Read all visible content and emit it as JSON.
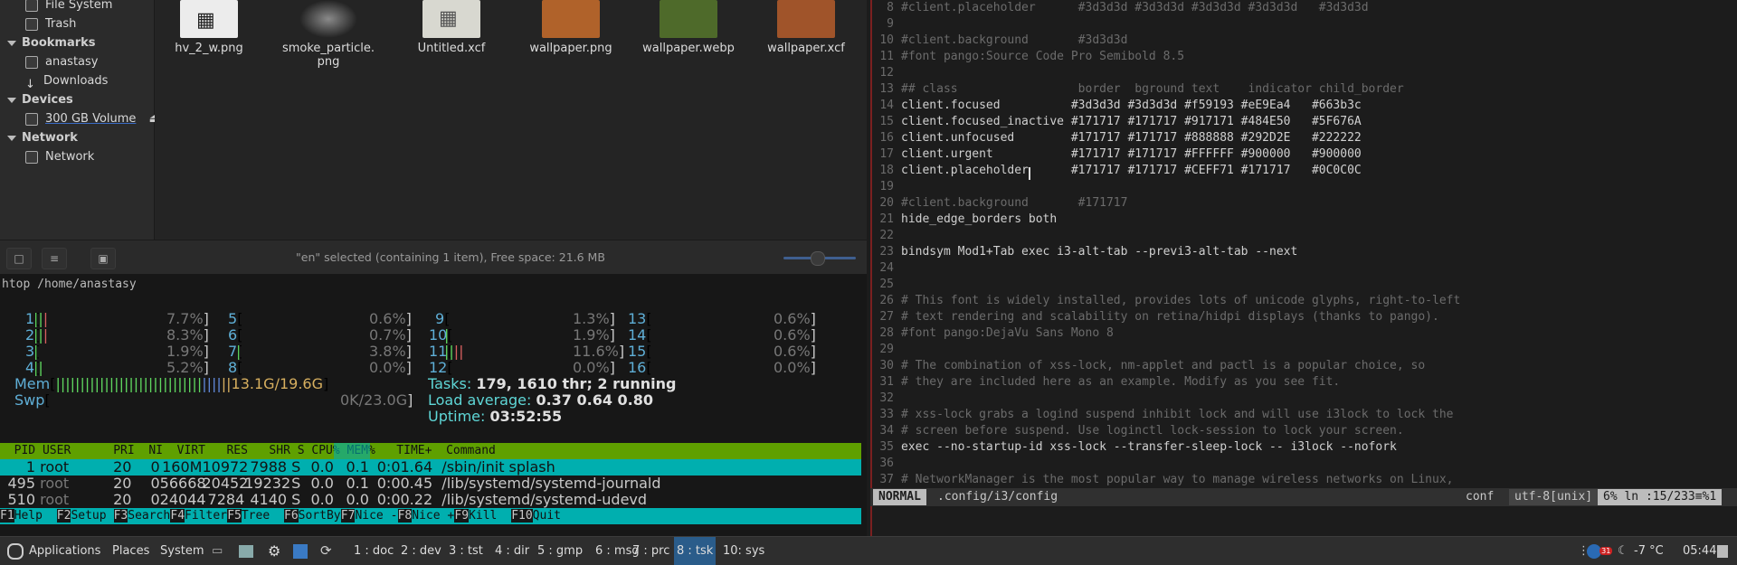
{
  "file_manager": {
    "sidebar": {
      "places": [
        {
          "label": "File System",
          "icon": "drive-icon"
        },
        {
          "label": "Trash",
          "icon": "trash-icon"
        }
      ],
      "bookmarks_heading": "Bookmarks",
      "bookmarks": [
        {
          "label": "anastasy",
          "icon": "folder-icon"
        },
        {
          "label": "Downloads",
          "icon": "download-icon"
        }
      ],
      "devices_heading": "Devices",
      "devices": [
        {
          "label": "300 GB Volume",
          "icon": "drive-icon"
        }
      ],
      "network_heading": "Network",
      "network": [
        {
          "label": "Network",
          "icon": "network-icon"
        }
      ]
    },
    "files": [
      {
        "name": "hv_2_w.png",
        "thumb_color": "#e8e8e8"
      },
      {
        "name": "smoke_particle.\npng",
        "thumb_color": "#555555"
      },
      {
        "name": "Untitled.xcf",
        "thumb_color": "#d8d8d0"
      },
      {
        "name": "wallpaper.png",
        "thumb_color": "#b0622a"
      },
      {
        "name": "wallpaper.webp",
        "thumb_color": "#4e6a2a"
      },
      {
        "name": "wallpaper.xcf",
        "thumb_color": "#a0542a"
      }
    ],
    "status_text": "\"en\" selected (containing 1 item), Free space: 21.6 MB"
  },
  "htop": {
    "title": "htop /home/anastasy",
    "cpus": [
      {
        "n": "1",
        "pct": "7.7%"
      },
      {
        "n": "2",
        "pct": "8.3%"
      },
      {
        "n": "3",
        "pct": "1.9%"
      },
      {
        "n": "4",
        "pct": "5.2%"
      },
      {
        "n": "5",
        "pct": "0.6%"
      },
      {
        "n": "6",
        "pct": "0.7%"
      },
      {
        "n": "7",
        "pct": "3.8%"
      },
      {
        "n": "8",
        "pct": "0.0%"
      },
      {
        "n": "9",
        "pct": "1.3%"
      },
      {
        "n": "10",
        "pct": "1.9%"
      },
      {
        "n": "11",
        "pct": "11.6%"
      },
      {
        "n": "12",
        "pct": "0.0%"
      },
      {
        "n": "13",
        "pct": "0.6%"
      },
      {
        "n": "14",
        "pct": "0.6%"
      },
      {
        "n": "15",
        "pct": "0.6%"
      },
      {
        "n": "16",
        "pct": "0.0%"
      }
    ],
    "mem_label": "Mem",
    "mem_value": "13.1G/19.6G",
    "swp_label": "Swp",
    "swp_value": "0K/23.0G",
    "tasks_label": "Tasks:",
    "tasks_value": "179, 1610 thr; 2 running",
    "load_label": "Load average:",
    "load_value": "0.37 0.64 0.80",
    "uptime_label": "Uptime:",
    "uptime_value": "03:52:55",
    "header": "  PID USER      PRI  NI  VIRT   RES   SHR S CPU% MEM%   TIME+  Command",
    "processes": [
      {
        "pid": "1",
        "user": "root",
        "pri": "20",
        "ni": "0",
        "virt": "160M",
        "res": "10972",
        "shr": "7988",
        "s": "S",
        "cpu": "0.0",
        "mem": "0.1",
        "time": "0:01.64",
        "cmd": "/sbin/init splash"
      },
      {
        "pid": "495",
        "user": "root",
        "pri": "20",
        "ni": "0",
        "virt": "56668",
        "res": "20452",
        "shr": "19232",
        "s": "S",
        "cpu": "0.0",
        "mem": "0.1",
        "time": "0:00.45",
        "cmd": "/lib/systemd/systemd-journald"
      },
      {
        "pid": "510",
        "user": "root",
        "pri": "20",
        "ni": "0",
        "virt": "24044",
        "res": "7284",
        "shr": "4140",
        "s": "S",
        "cpu": "0.0",
        "mem": "0.0",
        "time": "0:00.22",
        "cmd": "/lib/systemd/systemd-udevd"
      }
    ],
    "fkeys": [
      {
        "key": "F1",
        "label": "Help  "
      },
      {
        "key": "F2",
        "label": "Setup "
      },
      {
        "key": "F3",
        "label": "Search"
      },
      {
        "key": "F4",
        "label": "Filter"
      },
      {
        "key": "F5",
        "label": "Tree  "
      },
      {
        "key": "F6",
        "label": "SortBy"
      },
      {
        "key": "F7",
        "label": "Nice -"
      },
      {
        "key": "F8",
        "label": "Nice +"
      },
      {
        "key": "F9",
        "label": "Kill  "
      },
      {
        "key": "F10",
        "label": "Quit"
      }
    ]
  },
  "vim": {
    "lines": [
      {
        "n": "8",
        "text": "#client.placeholder      #3d3d3d #3d3d3d #3d3d3d #3d3d3d   #3d3d3d",
        "comment": true
      },
      {
        "n": "9",
        "text": "",
        "comment": false
      },
      {
        "n": "10",
        "text": "#client.background       #3d3d3d",
        "comment": true
      },
      {
        "n": "11",
        "text": "#font pango:Source Code Pro Semibold 8.5",
        "comment": true
      },
      {
        "n": "12",
        "text": "",
        "comment": false
      },
      {
        "n": "13",
        "text": "## class                 border  bground text    indicator child_border",
        "comment": true
      },
      {
        "n": "14",
        "text": "client.focused          #3d3d3d #3d3d3d #f59193 #eE9Ea4   #663b3c",
        "comment": false
      },
      {
        "n": "15",
        "text": "client.focused_inactive #171717 #171717 #917171 #484E50   #5F676A",
        "comment": false
      },
      {
        "n": "16",
        "text": "client.unfocused        #171717 #171717 #888888 #292D2E   #222222",
        "comment": false
      },
      {
        "n": "17",
        "text": "client.urgent           #171717 #171717 #FFFFFF #900000   #900000",
        "comment": false
      },
      {
        "n": "18",
        "text": "client.placeholder      #171717 #171717 #CEFF71 #171717   #0C0C0C",
        "comment": false
      },
      {
        "n": "19",
        "text": "",
        "comment": false
      },
      {
        "n": "20",
        "text": "#client.background       #171717",
        "comment": true
      },
      {
        "n": "21",
        "text": "hide_edge_borders both",
        "comment": false
      },
      {
        "n": "22",
        "text": "",
        "comment": false
      },
      {
        "n": "23",
        "text": "bindsym Mod1+Tab exec i3-alt-tab --previ3-alt-tab --next",
        "comment": false
      },
      {
        "n": "24",
        "text": "",
        "comment": false
      },
      {
        "n": "25",
        "text": "",
        "comment": false
      },
      {
        "n": "26",
        "text": "# This font is widely installed, provides lots of unicode glyphs, right-to-left",
        "comment": true
      },
      {
        "n": "27",
        "text": "# text rendering and scalability on retina/hidpi displays (thanks to pango).",
        "comment": true
      },
      {
        "n": "28",
        "text": "#font pango:DejaVu Sans Mono 8",
        "comment": true
      },
      {
        "n": "29",
        "text": "",
        "comment": false
      },
      {
        "n": "30",
        "text": "# The combination of xss-lock, nm-applet and pactl is a popular choice, so",
        "comment": true
      },
      {
        "n": "31",
        "text": "# they are included here as an example. Modify as you see fit.",
        "comment": true
      },
      {
        "n": "32",
        "text": "",
        "comment": false
      },
      {
        "n": "33",
        "text": "# xss-lock grabs a logind suspend inhibit lock and will use i3lock to lock the",
        "comment": true
      },
      {
        "n": "34",
        "text": "# screen before suspend. Use loginctl lock-session to lock your screen.",
        "comment": true
      },
      {
        "n": "35",
        "text": "exec --no-startup-id xss-lock --transfer-sleep-lock -- i3lock --nofork",
        "comment": false
      },
      {
        "n": "36",
        "text": "",
        "comment": false
      },
      {
        "n": "37",
        "text": "# NetworkManager is the most popular way to manage wireless networks on Linux,",
        "comment": true
      }
    ],
    "mode": "NORMAL",
    "file_path": ".config/i3/config",
    "filetype": "conf",
    "encoding": "utf-8[unix]",
    "position": "6%  ln :15/233≡%1"
  },
  "taskbar": {
    "applications": "Applications",
    "places": "Places",
    "system": "System",
    "workspaces": [
      {
        "label": "1 : doc",
        "active": false
      },
      {
        "label": "2 : dev",
        "active": false
      },
      {
        "label": "3 : tst",
        "active": false
      },
      {
        "label": "4 : dir",
        "active": false
      },
      {
        "label": "5 : gmp",
        "active": false
      },
      {
        "label": "6 : msg",
        "active": false
      },
      {
        "label": "7 : prc",
        "active": false
      },
      {
        "label": "8 : tsk",
        "active": true
      },
      {
        "label": "10: sys",
        "active": false
      }
    ],
    "weather": "-7 °C",
    "clock": "05:44",
    "notification_count": "31"
  }
}
